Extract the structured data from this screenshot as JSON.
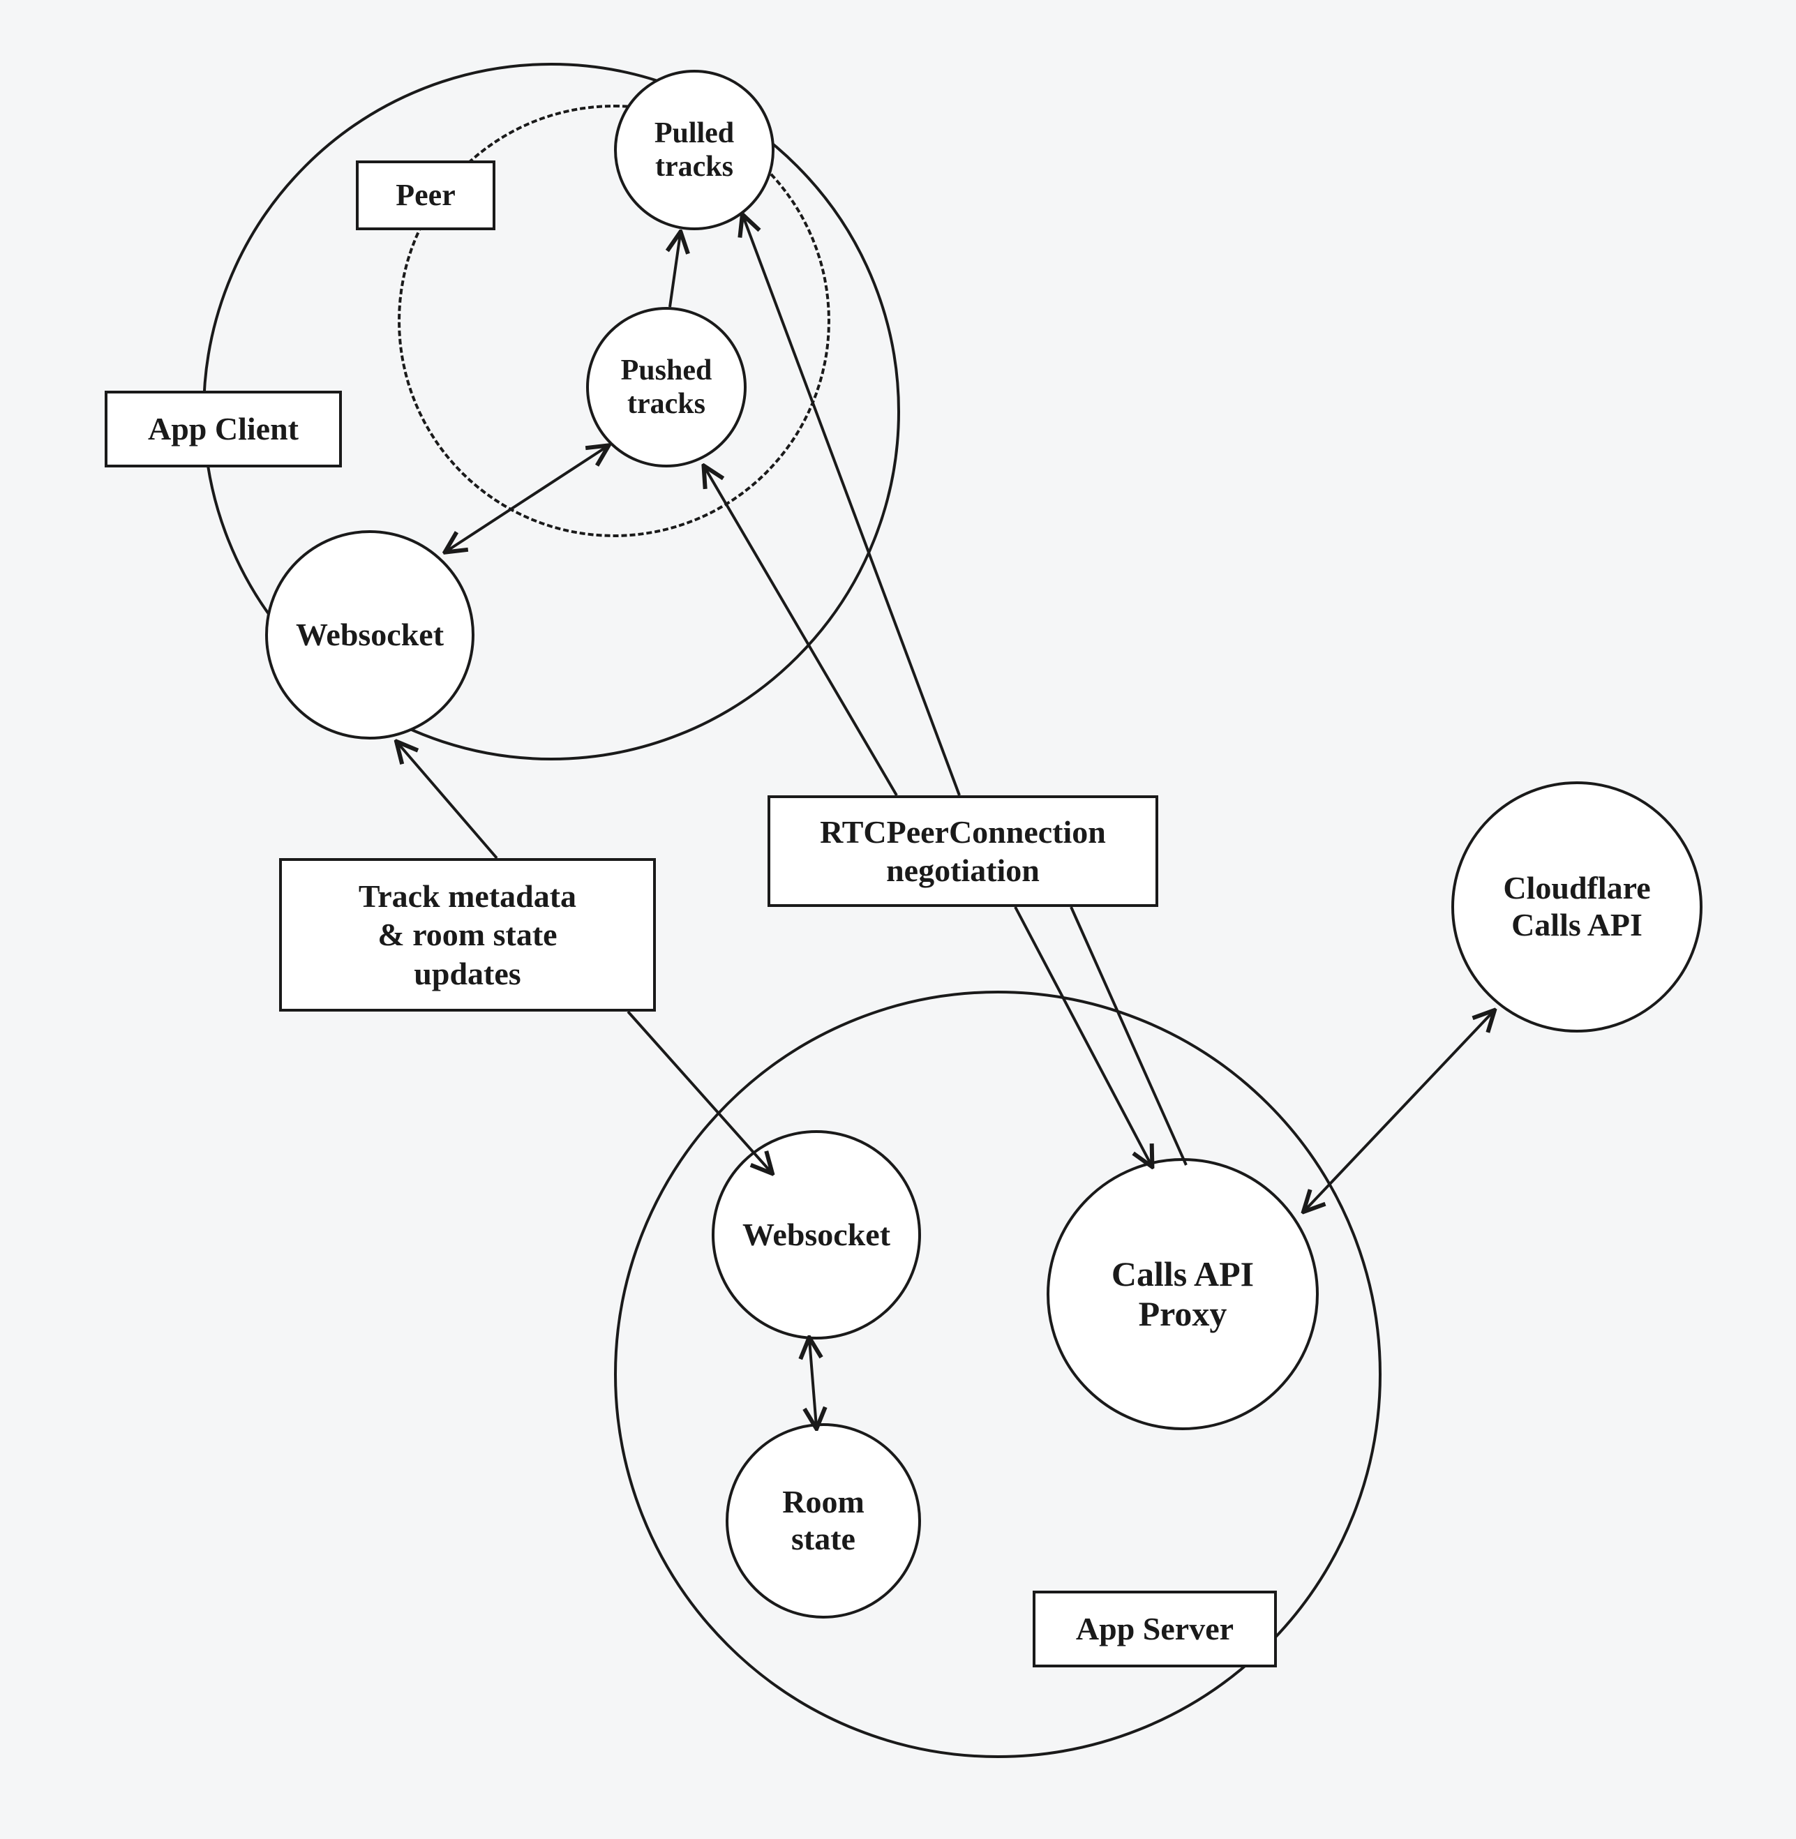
{
  "diagram": {
    "groups": {
      "app_client": "App Client",
      "app_server": "App Server",
      "peer": "Peer"
    },
    "nodes": {
      "pulled_tracks": "Pulled\ntracks",
      "pushed_tracks": "Pushed\ntracks",
      "websocket_client": "Websocket",
      "websocket_server": "Websocket",
      "room_state": "Room\nstate",
      "calls_api_proxy": "Calls API\nProxy",
      "cloudflare_calls_api": "Cloudflare\nCalls API"
    },
    "edges": {
      "track_metadata": "Track metadata\n& room state\nupdates",
      "rtc_negotiation": "RTCPeerConnection\nnegotiation"
    }
  }
}
